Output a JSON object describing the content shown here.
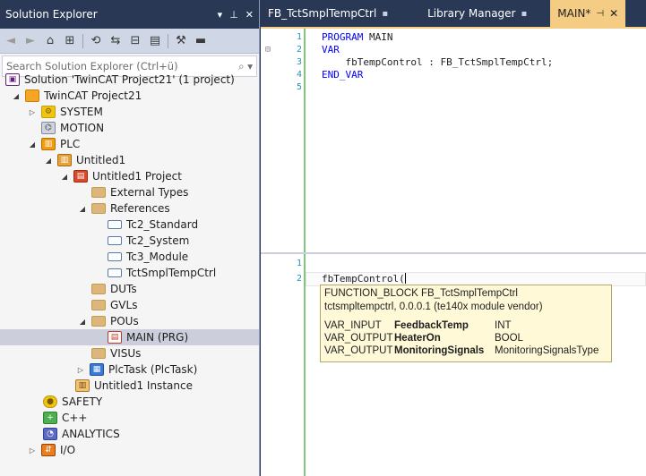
{
  "solution_explorer": {
    "title": "Solution Explorer",
    "search_placeholder": "Search Solution Explorer (Ctrl+ü)",
    "tree": [
      {
        "label": "Solution 'TwinCAT Project21' (1 project)",
        "icon": "solution-icon"
      },
      {
        "label": "TwinCAT Project21",
        "icon": "twincat-project-icon",
        "expanded": true
      },
      {
        "label": "SYSTEM",
        "icon": "system-icon",
        "expanded": false
      },
      {
        "label": "MOTION",
        "icon": "motion-icon"
      },
      {
        "label": "PLC",
        "icon": "plc-icon",
        "expanded": true
      },
      {
        "label": "Untitled1",
        "icon": "plc-project-icon",
        "expanded": true
      },
      {
        "label": "Untitled1 Project",
        "icon": "plc-subproject-icon",
        "expanded": true
      },
      {
        "label": "External Types",
        "icon": "folder-icon"
      },
      {
        "label": "References",
        "icon": "folder-open-icon",
        "expanded": true
      },
      {
        "label": "Tc2_Standard",
        "icon": "reference-icon"
      },
      {
        "label": "Tc2_System",
        "icon": "reference-icon"
      },
      {
        "label": "Tc3_Module",
        "icon": "reference-icon"
      },
      {
        "label": "TctSmplTempCtrl",
        "icon": "reference-icon"
      },
      {
        "label": "DUTs",
        "icon": "folder-icon"
      },
      {
        "label": "GVLs",
        "icon": "folder-icon"
      },
      {
        "label": "POUs",
        "icon": "folder-open-icon",
        "expanded": true
      },
      {
        "label": "MAIN (PRG)",
        "icon": "pou-icon",
        "selected": true
      },
      {
        "label": "VISUs",
        "icon": "folder-icon"
      },
      {
        "label": "PlcTask (PlcTask)",
        "icon": "task-icon",
        "expanded": false
      },
      {
        "label": "Untitled1 Instance",
        "icon": "instance-icon"
      },
      {
        "label": "SAFETY",
        "icon": "safety-icon"
      },
      {
        "label": "C++",
        "icon": "cpp-icon"
      },
      {
        "label": "ANALYTICS",
        "icon": "analytics-icon"
      },
      {
        "label": "I/O",
        "icon": "io-icon",
        "expanded": false
      }
    ]
  },
  "editor": {
    "tabs": [
      {
        "label": "FB_TctSmplTempCtrl",
        "active": false
      },
      {
        "label": "Library Manager",
        "active": false
      },
      {
        "label": "MAIN*",
        "active": true
      }
    ],
    "top_pane": {
      "lines": [
        {
          "num": "1",
          "parts": [
            {
              "t": "PROGRAM",
              "k": "kw"
            },
            {
              "t": " MAIN",
              "k": "plain"
            }
          ]
        },
        {
          "num": "2",
          "parts": [
            {
              "t": "VAR",
              "k": "kw"
            }
          ],
          "fold": "⊟"
        },
        {
          "num": "3",
          "parts": [
            {
              "t": "    fbTempControl : FB_TctSmplTempCtrl;",
              "k": "plain"
            }
          ]
        },
        {
          "num": "4",
          "parts": [
            {
              "t": "END_VAR",
              "k": "kw"
            }
          ]
        },
        {
          "num": "5",
          "parts": []
        }
      ]
    },
    "bottom_pane": {
      "lines": [
        {
          "num": "1",
          "text": ""
        },
        {
          "num": "2",
          "text": "fbTempControl("
        }
      ]
    },
    "tooltip": {
      "header1": "FUNCTION_BLOCK FB_TctSmplTempCtrl",
      "header2": "tctsmpltempctrl, 0.0.0.1 (te140x module vendor)",
      "vars": [
        {
          "kind": "VAR_INPUT",
          "name": "FeedbackTemp",
          "type": "INT"
        },
        {
          "kind": "VAR_OUTPUT",
          "name": "HeaterOn",
          "type": "BOOL"
        },
        {
          "kind": "VAR_OUTPUT",
          "name": "MonitoringSignals",
          "type": "MonitoringSignalsType"
        }
      ]
    }
  }
}
